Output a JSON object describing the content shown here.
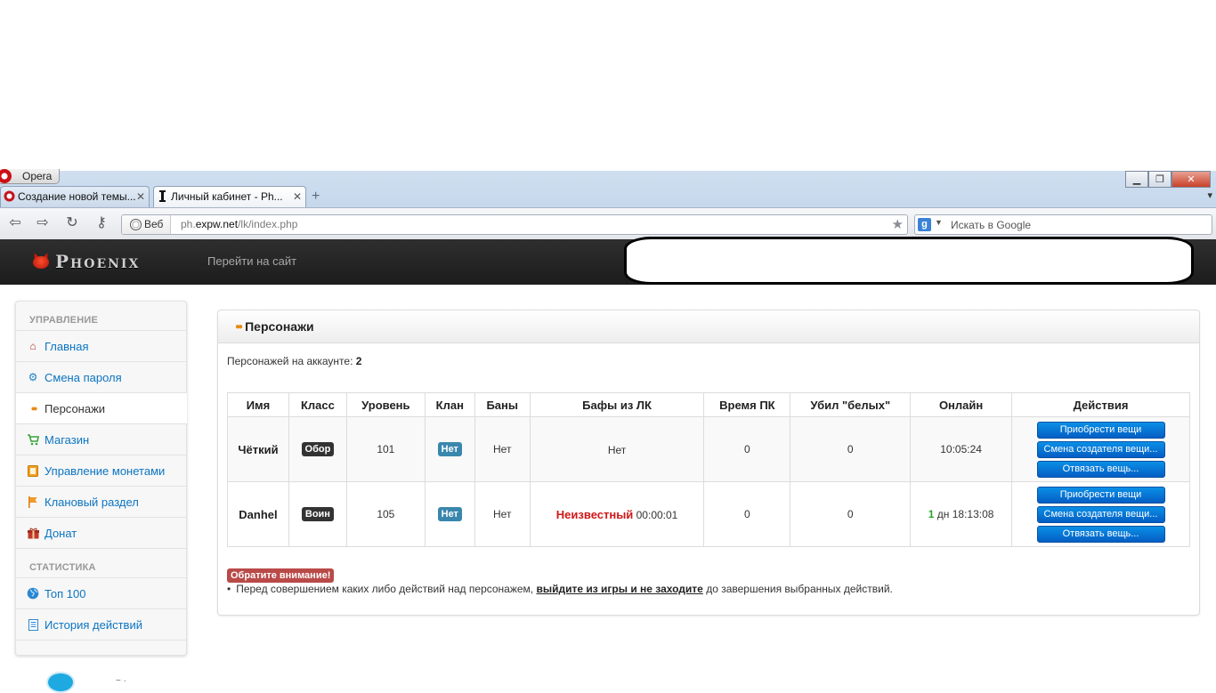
{
  "browser": {
    "menu_label": "Opera",
    "tabs": [
      {
        "title": "Создание новой темы..."
      },
      {
        "title": "Личный кабинет - Ph..."
      }
    ],
    "new_tab_symbol": "+",
    "nav": {
      "back": "⇦",
      "forward": "⇨",
      "reload": "↻",
      "key": "⚷"
    },
    "address": {
      "badge": "Веб",
      "url_prefix": "ph.",
      "url_domain": "expw.net",
      "url_path": "/lk/index.php"
    },
    "search_placeholder": "Искать в Google",
    "window_buttons": {
      "minimize": "▁",
      "restore": "❐",
      "close": "✕"
    }
  },
  "site": {
    "logo_text": "Phoenix",
    "goto_site": "Перейти на сайт"
  },
  "sidebar": {
    "sections": [
      {
        "header": "Управление",
        "items": [
          {
            "label": "Главная",
            "icon": "home-icon"
          },
          {
            "label": "Смена пароля",
            "icon": "gear-icon"
          },
          {
            "label": "Персонажи",
            "icon": "users-icon",
            "active": true
          },
          {
            "label": "Магазин",
            "icon": "cart-icon"
          },
          {
            "label": "Управление монетами",
            "icon": "coin-icon"
          },
          {
            "label": "Клановый раздел",
            "icon": "flag-icon"
          },
          {
            "label": "Донат",
            "icon": "gift-icon"
          }
        ]
      },
      {
        "header": "Статистика",
        "items": [
          {
            "label": "Топ 100",
            "icon": "globe-icon"
          },
          {
            "label": "История действий",
            "icon": "document-icon"
          }
        ]
      }
    ]
  },
  "panel": {
    "title": "Персонажи",
    "count_label": "Персонажей на аккаунте: ",
    "count_value": "2",
    "columns": [
      "Имя",
      "Класс",
      "Уровень",
      "Клан",
      "Баны",
      "Бафы из ЛК",
      "Время ПК",
      "Убил \"белых\"",
      "Онлайн",
      "Действия"
    ],
    "rows": [
      {
        "name": "Чёткий",
        "class": "Обор",
        "level": "101",
        "clan": "Нет",
        "bans": "Нет",
        "buffs_name": "",
        "buffs_time": "Нет",
        "pk_time": "0",
        "killed_white": "0",
        "online_days": "",
        "online_rest": "10:05:24"
      },
      {
        "name": "Danhel",
        "class": "Воин",
        "level": "105",
        "clan": "Нет",
        "bans": "Нет",
        "buffs_name": "Неизвестный",
        "buffs_time": " 00:00:01",
        "pk_time": "0",
        "killed_white": "0",
        "online_days": "1",
        "online_rest": " дн 18:13:08"
      }
    ],
    "actions": [
      "Приобрести вещи",
      "Смена создателя вещи...",
      "Отвязать вещь..."
    ],
    "notice_label": "Обратите внимание!",
    "notice_text_before": "Перед совершением каких либо действий над персонажем, ",
    "notice_text_bold": "выйдите из игры и не заходите",
    "notice_text_after": " до завершения выбранных действий."
  },
  "colors": {
    "link": "#0b74c2",
    "button": "#0a78d6",
    "notice": "#b94a48",
    "header": "#232323",
    "clan_label": "#3a87ad"
  }
}
